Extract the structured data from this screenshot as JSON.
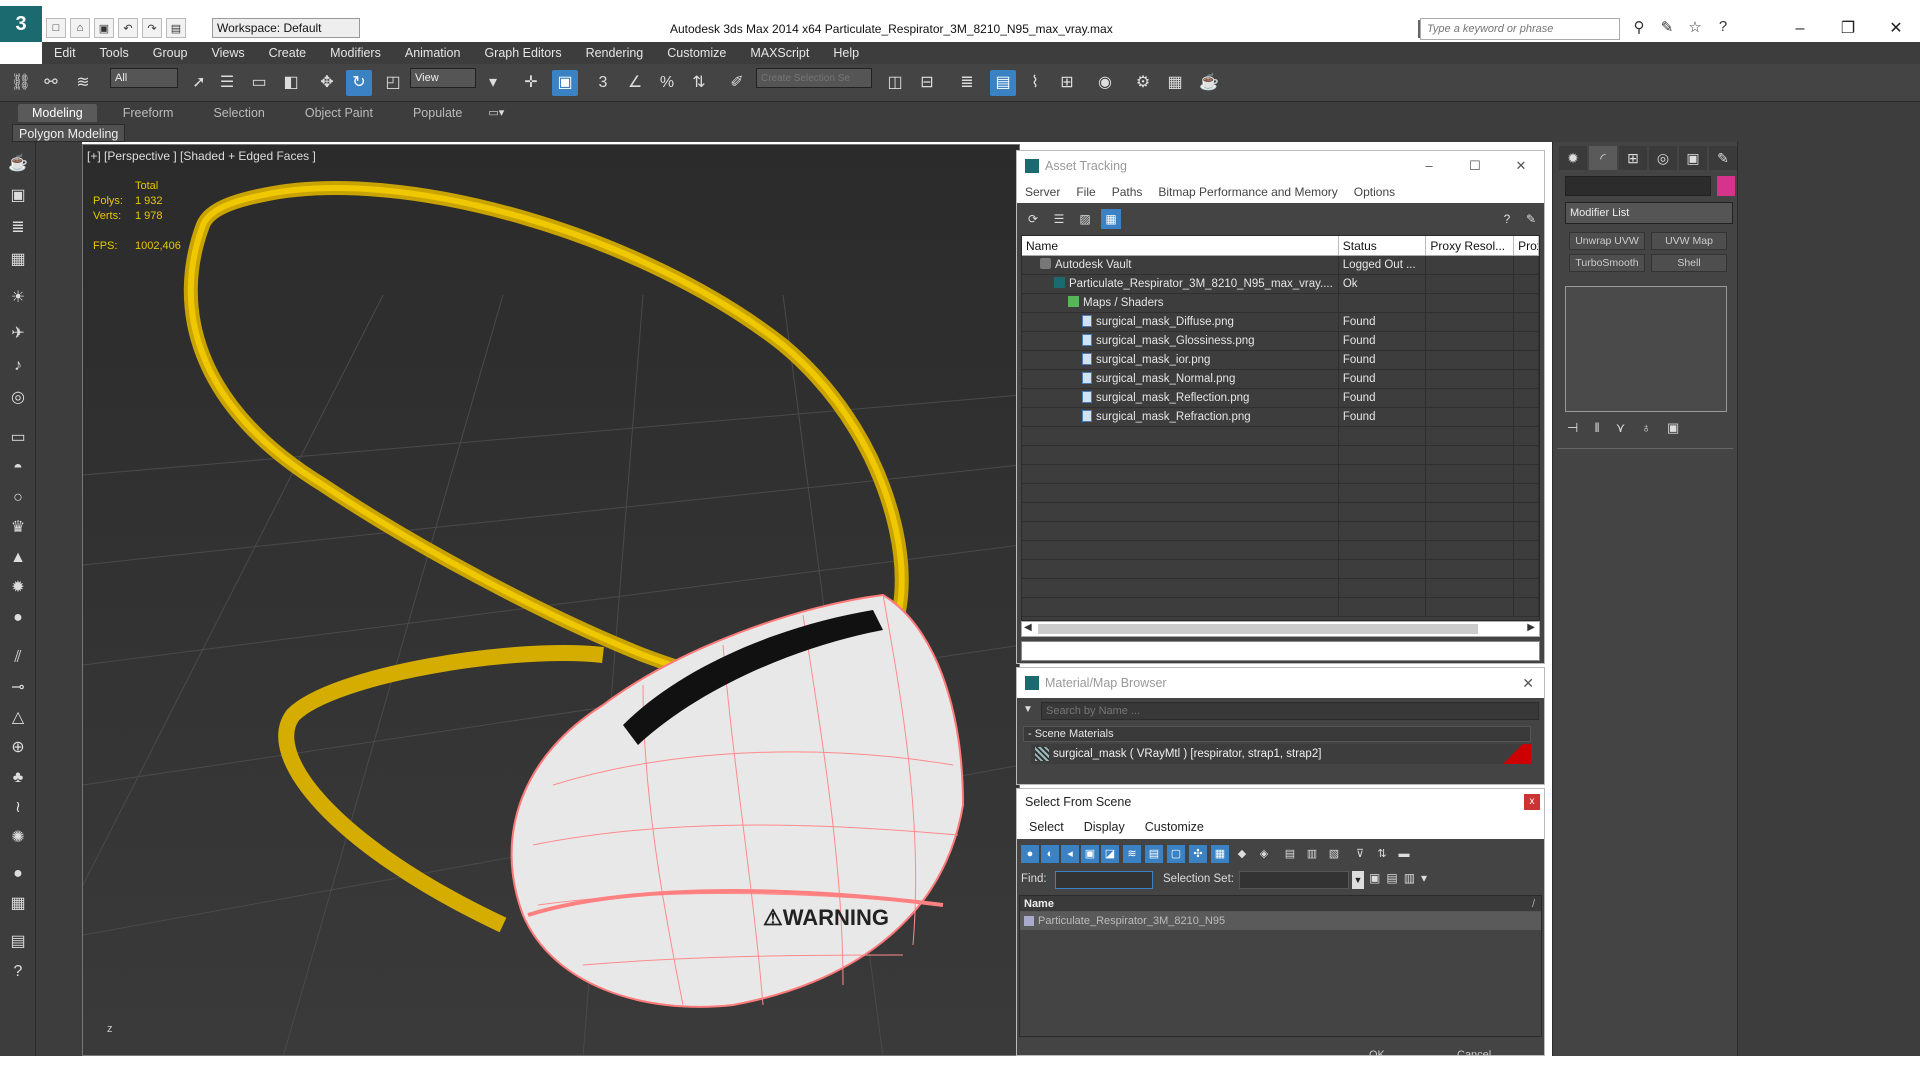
{
  "app": {
    "title": "Autodesk 3ds Max  2014 x64     Particulate_Respirator_3M_8210_N95_max_vray.max",
    "logo": "3",
    "workspace": "Workspace: Default",
    "search_placeholder": "Type a keyword or phrase"
  },
  "menu": [
    "Edit",
    "Tools",
    "Group",
    "Views",
    "Create",
    "Modifiers",
    "Animation",
    "Graph Editors",
    "Rendering",
    "Customize",
    "MAXScript",
    "Help"
  ],
  "toolbar": {
    "filter": "All",
    "refcoord": "View",
    "selection_set_placeholder": "Create Selection Se"
  },
  "ribbon": {
    "tabs": [
      "Modeling",
      "Freeform",
      "Selection",
      "Object Paint",
      "Populate"
    ],
    "active_tab": "Modeling",
    "panel_label": "Polygon Modeling"
  },
  "viewport": {
    "label": "[+] [Perspective ] [Shaded + Edged Faces ]",
    "stats_header": "Total",
    "polys_label": "Polys:",
    "polys_value": "1 932",
    "verts_label": "Verts:",
    "verts_value": "1 978",
    "fps_label": "FPS:",
    "fps_value": "1002,406",
    "gizmo_z": "z"
  },
  "command_panel": {
    "modifier_list": "Modifier List",
    "modifier_buttons": [
      "Unwrap UVW",
      "UVW Map",
      "TurboSmooth",
      "Shell"
    ],
    "object_color": "#d6338d"
  },
  "asset_tracking": {
    "title": "Asset Tracking",
    "menu": [
      "Server",
      "File",
      "Paths",
      "Bitmap Performance and Memory",
      "Options"
    ],
    "columns": [
      "Name",
      "Status",
      "Proxy Resol...",
      "Prox"
    ],
    "rows": [
      {
        "name": "Autodesk Vault",
        "status": "Logged Out ...",
        "indent": 1,
        "icon": "vault-icon"
      },
      {
        "name": "Particulate_Respirator_3M_8210_N95_max_vray....",
        "status": "Ok",
        "indent": 2,
        "icon": "max-file-icon"
      },
      {
        "name": "Maps / Shaders",
        "status": "",
        "indent": 3,
        "icon": "maps-folder-icon"
      },
      {
        "name": "surgical_mask_Diffuse.png",
        "status": "Found",
        "indent": 4,
        "icon": "bitmap-icon"
      },
      {
        "name": "surgical_mask_Glossiness.png",
        "status": "Found",
        "indent": 4,
        "icon": "bitmap-icon"
      },
      {
        "name": "surgical_mask_ior.png",
        "status": "Found",
        "indent": 4,
        "icon": "bitmap-icon"
      },
      {
        "name": "surgical_mask_Normal.png",
        "status": "Found",
        "indent": 4,
        "icon": "bitmap-icon"
      },
      {
        "name": "surgical_mask_Reflection.png",
        "status": "Found",
        "indent": 4,
        "icon": "bitmap-icon"
      },
      {
        "name": "surgical_mask_Refraction.png",
        "status": "Found",
        "indent": 4,
        "icon": "bitmap-icon"
      }
    ],
    "empty_rows": 10
  },
  "material_browser": {
    "title": "Material/Map Browser",
    "search_placeholder": "Search by Name ...",
    "group": "- Scene Materials",
    "item": "surgical_mask  ( VRayMtl )  [respirator, strap1, strap2]"
  },
  "select_from_scene": {
    "title": "Select From Scene",
    "close": "x",
    "menu": [
      "Select",
      "Display",
      "Customize"
    ],
    "find_label": "Find:",
    "selection_set_label": "Selection Set:",
    "column": "Name",
    "sort_indicator": "/",
    "objects": [
      "Particulate_Respirator_3M_8210_N95"
    ],
    "ok": "OK",
    "cancel": "Cancel"
  }
}
